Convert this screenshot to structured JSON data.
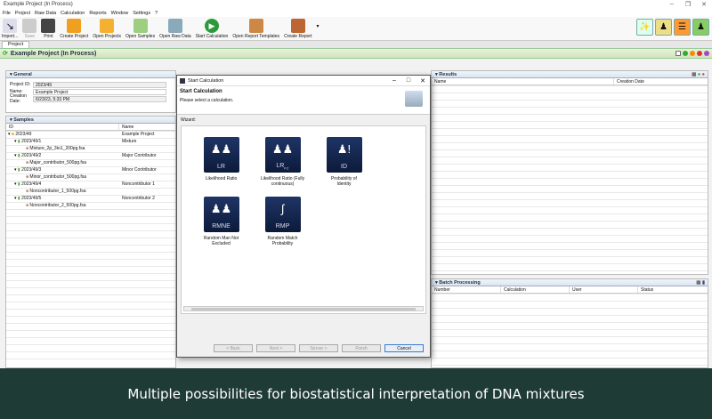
{
  "window": {
    "title": "Example Project (In Process)"
  },
  "menu": [
    "File",
    "Project",
    "Raw Data",
    "Calculation",
    "Reports",
    "Window",
    "Settings",
    "?"
  ],
  "toolbar": {
    "import": "Import...",
    "save": "Save",
    "print": "Print",
    "create_project": "Create Project",
    "open_projects": "Open Projects",
    "open_samples": "Open Samples",
    "open_raw_data": "Open Raw Data",
    "start_calculation": "Start Calculation",
    "open_report_templates": "Open Report Templates",
    "create_report": "Create Report"
  },
  "tab": "Project",
  "project_header": "Example Project (In Process)",
  "general": {
    "header": "General",
    "project_id_label": "Project ID:",
    "project_id": "2023/49",
    "name_label": "Name:",
    "name": "Example Project",
    "creation_label": "Creation Date:",
    "creation": "6/23/23, 5:33 PM"
  },
  "samples": {
    "header": "Samples",
    "col_id": "ID",
    "col_name": "Name",
    "rows": [
      {
        "id": "2023/49",
        "name": "Example Project"
      },
      {
        "id": "2023/49/1",
        "name": "Mixture"
      },
      {
        "id": "Mixture_2p_3to1_200pg.fsa",
        "name": ""
      },
      {
        "id": "2023/49/2",
        "name": "Major Contributor"
      },
      {
        "id": "Major_contributor_500pg.fsa",
        "name": ""
      },
      {
        "id": "2023/49/3",
        "name": "Minor Contributor"
      },
      {
        "id": "Minor_contributor_500pg.fsa",
        "name": ""
      },
      {
        "id": "2023/49/4",
        "name": "Noncontributor 1"
      },
      {
        "id": "Noncontributor_1_500pg.fsa",
        "name": ""
      },
      {
        "id": "2023/49/5",
        "name": "Noncontributor 2"
      },
      {
        "id": "Noncontributor_2_500pg.fsa",
        "name": ""
      }
    ]
  },
  "results": {
    "header": "Results",
    "col_name": "Name",
    "col_date": "Creation Date"
  },
  "batch": {
    "header": "Batch Processing",
    "cols": [
      "Number",
      "Calculation",
      "User",
      "Status"
    ]
  },
  "dialog": {
    "title": "Start Calculation",
    "heading": "Start Calculation",
    "subheading": "Please select a calculation.",
    "wizard_label": "Wizard:",
    "tiles": [
      {
        "abbr": "LR",
        "label": "Likelihood Ratio"
      },
      {
        "abbr": "LR",
        "sub": "FC",
        "label": "Likelihood Ratio (Fully continuous)"
      },
      {
        "abbr": "ID",
        "label": "Probability of Identity"
      },
      {
        "abbr": "RMNE",
        "label": "Random Man Not Excluded"
      },
      {
        "abbr": "RMP",
        "label": "Random Match Probability"
      }
    ],
    "buttons": {
      "back": "< Back",
      "next": "Next >",
      "server": "Server >",
      "finish": "Finish",
      "cancel": "Cancel"
    }
  },
  "caption": "Multiple possibilities for biostatistical interpretation of DNA mixtures",
  "colors": {
    "accent": "#3a7bd5",
    "caption_bg": "#1f3b36",
    "tile_bg": "#1f3566"
  }
}
